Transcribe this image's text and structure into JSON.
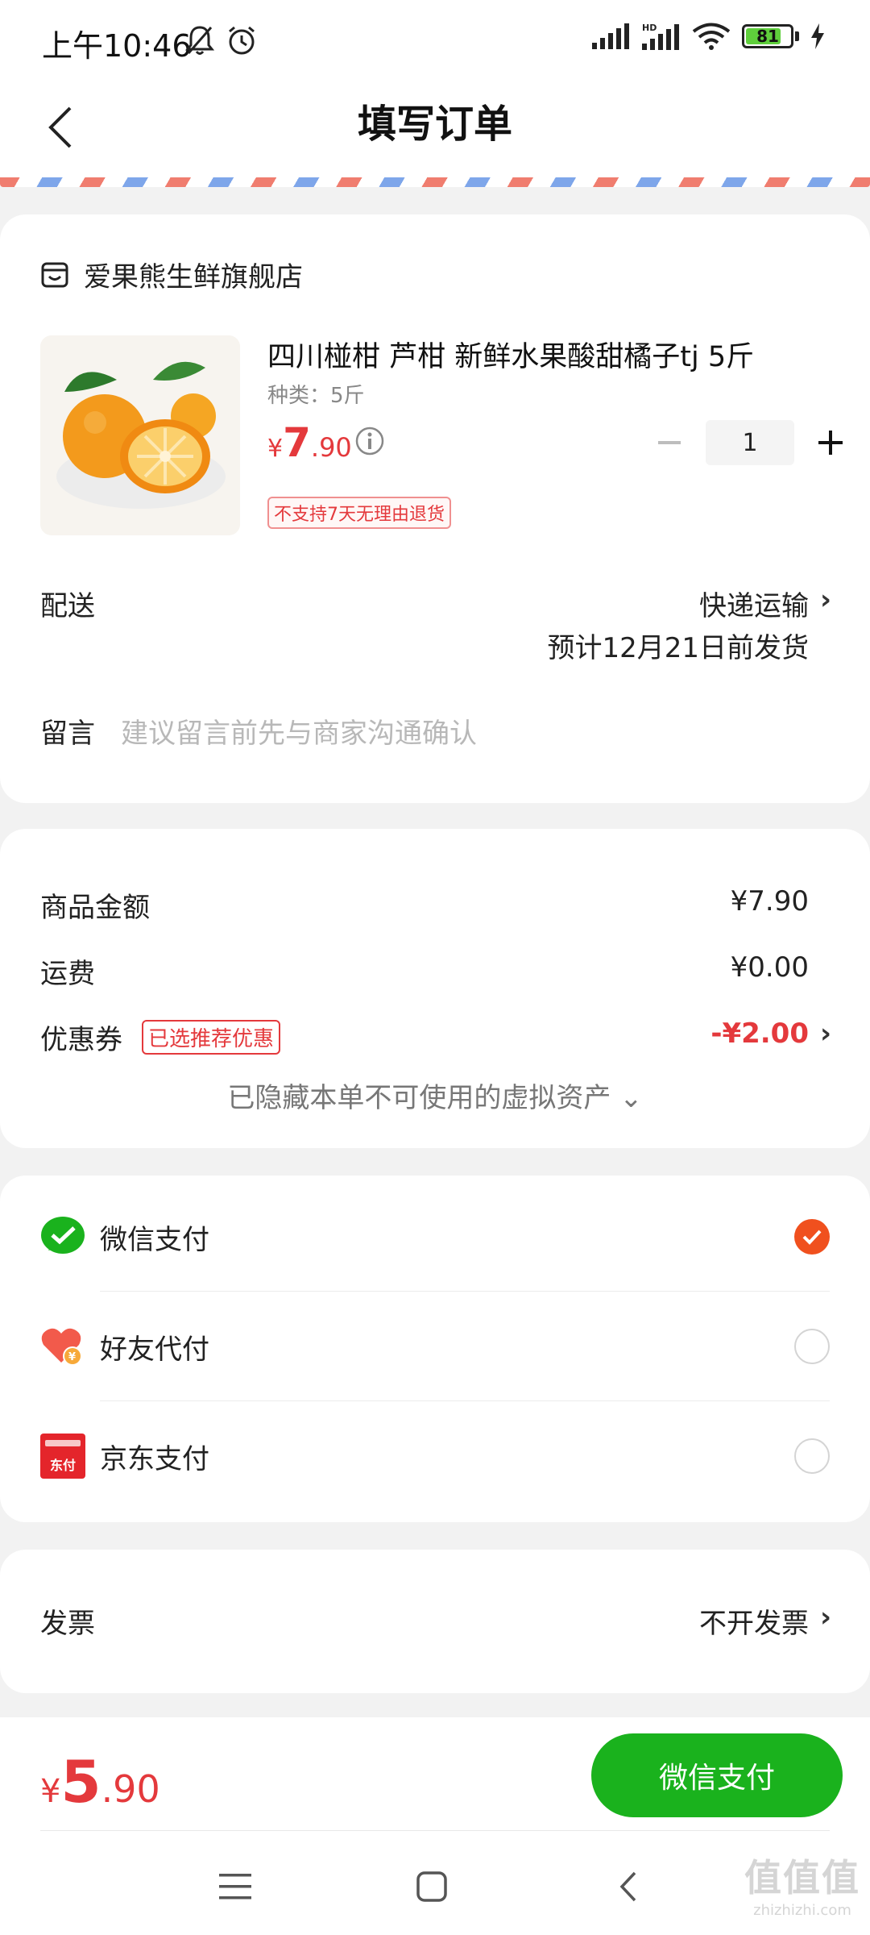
{
  "status_bar": {
    "time": "上午10:46",
    "battery": "81",
    "battery_level_percent": 81
  },
  "nav": {
    "title": "填写订单"
  },
  "store": {
    "name": "爱果熊生鲜旗舰店"
  },
  "product": {
    "title": "四川椪柑 芦柑 新鲜水果酸甜橘子tj 5斤",
    "spec": "种类：5斤",
    "price_symbol": "¥",
    "price_int": "7",
    "price_dec": ".90",
    "quantity": "1",
    "return_policy": "不支持7天无理由退货"
  },
  "delivery": {
    "label": "配送",
    "method": "快递运输",
    "eta": "预计12月21日前发货"
  },
  "message": {
    "label": "留言",
    "placeholder": "建议留言前先与商家沟通确认"
  },
  "summary": {
    "goods_label": "商品金额",
    "goods_value": "¥7.90",
    "shipping_label": "运费",
    "shipping_value": "¥0.00",
    "coupon_label": "优惠券",
    "coupon_tag": "已选推荐优惠",
    "coupon_value": "-¥2.00",
    "hidden_assets": "已隐藏本单不可使用的虚拟资产 ⌄"
  },
  "payment": {
    "options": [
      {
        "label": "微信支付",
        "selected": true
      },
      {
        "label": "好友代付",
        "selected": false
      },
      {
        "label": "京东支付",
        "selected": false
      }
    ],
    "jd_icon_text": "东付"
  },
  "invoice": {
    "label": "发票",
    "value": "不开发票"
  },
  "bottom": {
    "total_symbol": "¥",
    "total_int": "5",
    "total_dec": ".90",
    "pay_button": "微信支付"
  },
  "watermark": {
    "main": "值值值",
    "sub": "zhizhizhi.com"
  },
  "colors": {
    "accent_red": "#e4393c",
    "wechat_green": "#1ab21d",
    "check_orange": "#f0501e"
  }
}
